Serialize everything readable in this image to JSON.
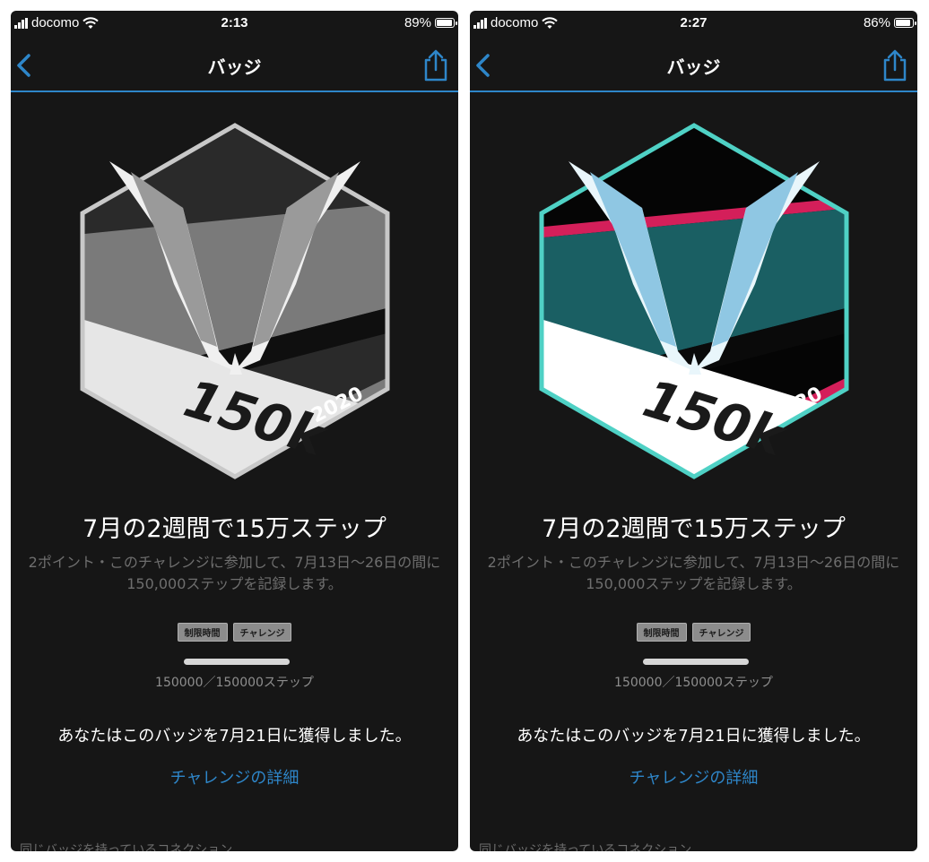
{
  "screens": [
    {
      "status": {
        "carrier": "docomo",
        "time": "2:13",
        "battery": "89%",
        "battery_level": 0.89
      },
      "nav": {
        "title": "バッジ",
        "back_icon": "chevron-left-icon",
        "share_icon": "share-icon"
      },
      "badge": {
        "main_text": "150k",
        "year": "2020",
        "colors": {
          "outline": "#c8c8c8",
          "upper": "#2a2a2a",
          "band": "#7a7a7a",
          "stripe": "#0f0f0f",
          "accent": "#7a7a7a",
          "ribbon": "#e6e6e6",
          "wing_light": "#f0f0f0",
          "wing_shadow": "#9a9a9a"
        }
      },
      "title": "7月の2週間で15万ステップ",
      "description": "2ポイント・このチャレンジに参加して、7月13日〜26日の間に150,000ステップを記録します。",
      "tags": [
        "制限時間",
        "チャレンジ"
      ],
      "progress": {
        "current": 150000,
        "goal": 150000,
        "fraction": 1.0,
        "text": "150000／150000ステップ"
      },
      "earned": "あなたはこのバッジを7月21日に獲得しました。",
      "details_link": "チャレンジの詳細",
      "connections_heading": "同じバッジを持っているコネクション"
    },
    {
      "status": {
        "carrier": "docomo",
        "time": "2:27",
        "battery": "86%",
        "battery_level": 0.86
      },
      "nav": {
        "title": "バッジ",
        "back_icon": "chevron-left-icon",
        "share_icon": "share-icon"
      },
      "badge": {
        "main_text": "150k",
        "year": "2020",
        "colors": {
          "outline": "#4fd1c5",
          "upper": "#050505",
          "band": "#1a5f63",
          "stripe": "#0a0a0a",
          "accent": "#d41f5a",
          "ribbon": "#ffffff",
          "wing_light": "#e9f6fb",
          "wing_shadow": "#8fc7e3"
        }
      },
      "title": "7月の2週間で15万ステップ",
      "description": "2ポイント・このチャレンジに参加して、7月13日〜26日の間に150,000ステップを記録します。",
      "tags": [
        "制限時間",
        "チャレンジ"
      ],
      "progress": {
        "current": 150000,
        "goal": 150000,
        "fraction": 1.0,
        "text": "150000／150000ステップ"
      },
      "earned": "あなたはこのバッジを7月21日に獲得しました。",
      "details_link": "チャレンジの詳細",
      "connections_heading": "同じバッジを持っているコネクション"
    }
  ]
}
